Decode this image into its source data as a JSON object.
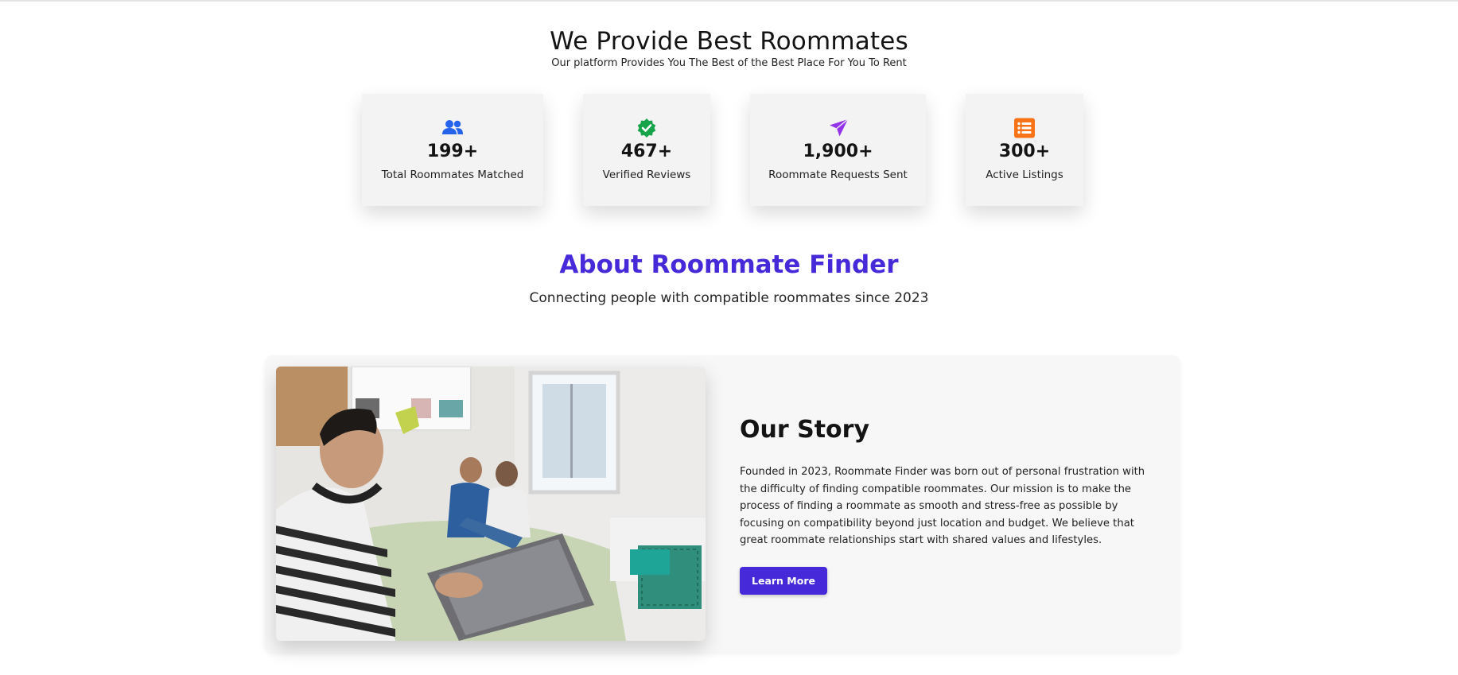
{
  "hero": {
    "title": "We Provide Best Roommates",
    "subtitle": "Our platform Provides You The Best of the Best Place For You To Rent"
  },
  "stats": [
    {
      "icon": "users-icon",
      "value": "199+",
      "label": "Total Roommates Matched",
      "color": "#2563eb"
    },
    {
      "icon": "verified-badge-icon",
      "value": "467+",
      "label": "Verified Reviews",
      "color": "#16a34a"
    },
    {
      "icon": "paper-plane-icon",
      "value": "1,900+",
      "label": "Roommate Requests Sent",
      "color": "#9333ea"
    },
    {
      "icon": "list-icon",
      "value": "300+",
      "label": "Active Listings",
      "color": "#f97316"
    }
  ],
  "about": {
    "title": "About Roommate Finder",
    "subtitle": "Connecting people with compatible roommates since 2023",
    "accent_color": "#4629d8"
  },
  "story": {
    "title": "Our Story",
    "body": "Founded in 2023, Roommate Finder was born out of personal frustration with the difficulty of finding compatible roommates. Our mission is to make the process of finding a roommate as smooth and stress-free as possible by focusing on compatibility beyond just location and budget. We believe that great roommate relationships start with shared values and lifestyles.",
    "button_label": "Learn More",
    "image_alt": "roommates-photo"
  }
}
